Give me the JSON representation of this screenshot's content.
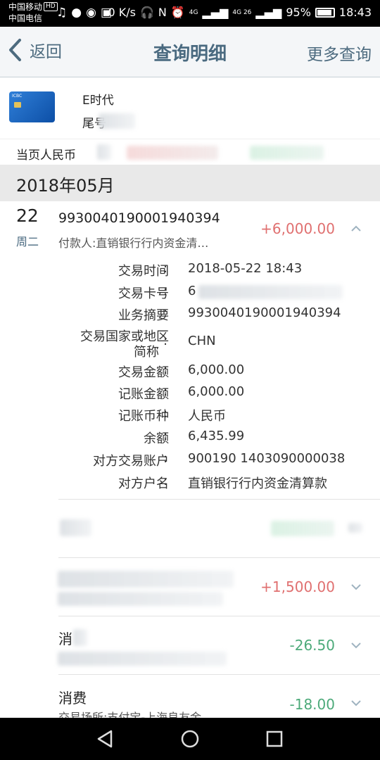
{
  "status_bar": {
    "carrier1": "中国移动",
    "carrier2": "中国电信",
    "hd": "HD",
    "net_speed": "0 K/s",
    "signal1": "4G",
    "signal2": "4G 26",
    "battery_pct": "95%",
    "time": "18:43"
  },
  "nav": {
    "back_label": "返回",
    "title": "查询明细",
    "more_label": "更多查询"
  },
  "card": {
    "name": "E时代",
    "tail": "尾号"
  },
  "summary": {
    "text": "当页人民币"
  },
  "month": "2018年05月",
  "expanded_txn": {
    "day": "22",
    "weekday": "周二",
    "id": "9930040190001940394",
    "payer": "付款人:直销银行行内资金清…",
    "amount": "+6,000.00",
    "details": [
      {
        "label": "交易时间",
        "value": "2018-05-22 18:43"
      },
      {
        "label": "交易卡号",
        "value": "6"
      },
      {
        "label": "业务摘要",
        "value": "9930040190001940394"
      },
      {
        "label": "交易国家或地区",
        "label2": "简称",
        "value": "CHN"
      },
      {
        "label": "交易金额",
        "value": "6,000.00"
      },
      {
        "label": "记账金额",
        "value": "6,000.00"
      },
      {
        "label": "记账币种",
        "value": "人民币"
      },
      {
        "label": "余额",
        "value": "6,435.99"
      },
      {
        "label": "对方交易账户",
        "value": "900190 1403090000038"
      },
      {
        "label": "对方户名",
        "value": "直销银行行内资金清算款"
      }
    ]
  },
  "other_txns": [
    {
      "title": "",
      "sub": "",
      "amount": "",
      "sign": "pos"
    },
    {
      "title": "",
      "sub": "",
      "amount": "+1,500.00",
      "sign": "pos"
    },
    {
      "title": "消",
      "sub": "",
      "amount": "-26.50",
      "sign": "neg"
    },
    {
      "title": "消费",
      "sub": "交易场所:支付宝-上海良友金",
      "amount": "-18.00",
      "sign": "neg"
    }
  ],
  "colors": {
    "positive": "#e07070",
    "negative": "#4daa7a",
    "nav_text": "#4a6a80"
  }
}
